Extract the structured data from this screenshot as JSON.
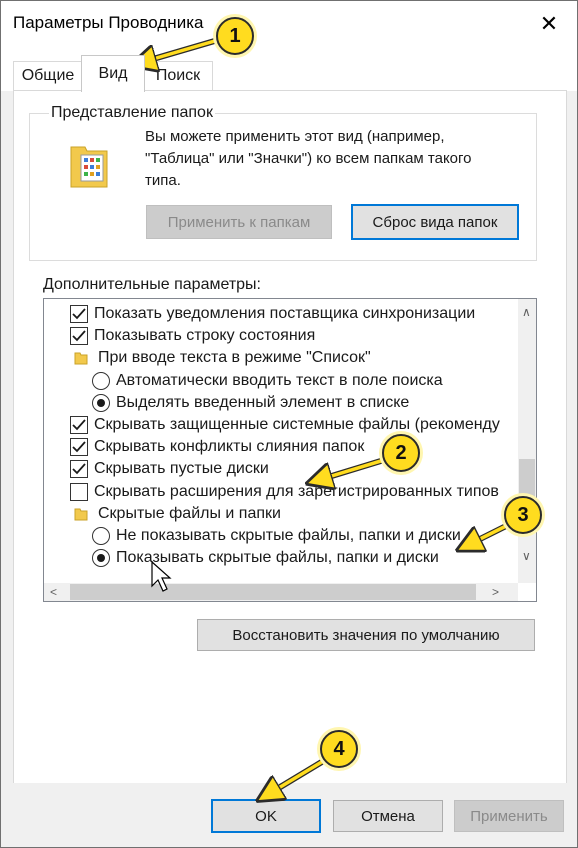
{
  "window": {
    "title": "Параметры Проводника",
    "close_glyph": "✕"
  },
  "tabs": [
    {
      "label": "Общие",
      "active": false
    },
    {
      "label": "Вид",
      "active": true
    },
    {
      "label": "Поиск",
      "active": false
    }
  ],
  "folder_views": {
    "group_label": "Представление папок",
    "description": "Вы можете применить этот вид (например, \"Таблица\" или \"Значки\") ко всем папкам такого типа.",
    "apply_button": "Применить к папкам",
    "reset_button": "Сброс вида папок"
  },
  "advanced": {
    "label": "Дополнительные параметры:",
    "items": [
      {
        "type": "checkbox",
        "checked": true,
        "indent": 0,
        "label": "Показать уведомления поставщика синхронизации"
      },
      {
        "type": "checkbox",
        "checked": true,
        "indent": 0,
        "label": "Показывать строку состояния"
      },
      {
        "type": "folder",
        "indent": 0,
        "label": "При вводе текста в режиме \"Список\""
      },
      {
        "type": "radio",
        "checked": false,
        "indent": 1,
        "label": "Автоматически вводить текст в поле поиска"
      },
      {
        "type": "radio",
        "checked": true,
        "indent": 1,
        "label": "Выделять введенный элемент в списке"
      },
      {
        "type": "checkbox",
        "checked": true,
        "indent": 0,
        "label": "Скрывать защищенные системные файлы (рекоменду"
      },
      {
        "type": "checkbox",
        "checked": true,
        "indent": 0,
        "label": "Скрывать конфликты слияния папок"
      },
      {
        "type": "checkbox",
        "checked": true,
        "indent": 0,
        "label": "Скрывать пустые диски"
      },
      {
        "type": "checkbox",
        "checked": false,
        "indent": 0,
        "label": "Скрывать расширения для зарегистрированных типов"
      },
      {
        "type": "folder",
        "indent": 0,
        "label": "Скрытые файлы и папки"
      },
      {
        "type": "radio",
        "checked": false,
        "indent": 1,
        "label": "Не показывать скрытые файлы, папки и диски"
      },
      {
        "type": "radio",
        "checked": true,
        "indent": 1,
        "label": "Показывать скрытые файлы, папки и диски"
      }
    ],
    "restore_button": "Восстановить значения по умолчанию"
  },
  "footer": {
    "ok": "OK",
    "cancel": "Отмена",
    "apply": "Применить"
  },
  "annotations": [
    "1",
    "2",
    "3",
    "4"
  ],
  "colors": {
    "badge": "#ffdc1f",
    "focus": "#0078d7"
  }
}
